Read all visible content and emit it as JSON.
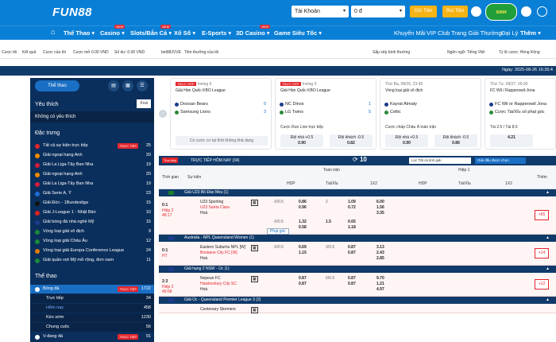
{
  "header": {
    "logo": "FUN88",
    "account_label": "Tài Khoản",
    "balance": "0 đ",
    "deposit_label": "Gửi Tiền",
    "withdraw_label": "Rút Tiền",
    "badge": "SINH THƯỞNG"
  },
  "nav": {
    "items": [
      {
        "label": "Thể Thao",
        "new": false
      },
      {
        "label": "Casino",
        "new": true
      },
      {
        "label": "Slots/Bắn Cá",
        "new": true
      },
      {
        "label": "Xổ Số",
        "new": false
      },
      {
        "label": "E-Sports",
        "new": false
      },
      {
        "label": "3D Casino",
        "new": true
      },
      {
        "label": "Game Siêu Tốc",
        "new": false
      }
    ],
    "right_items": [
      "Khuyến Mãi",
      "VIP Club",
      "Trang Giải Thưởng",
      "Đại Lý",
      "Thêm"
    ],
    "new_tag": "NEW"
  },
  "subbar": {
    "left": [
      "Cược tôi",
      "Kết quả",
      "Cược của tôi",
      "Cược mở 0.00 VND",
      "Số dư: 0.00 VND",
      "bet88JVVE",
      "Tiền thưởng của tôi"
    ],
    "right": [
      "Sắp xếp bình thường",
      "Ngôn ngữ: Tiếng Việt",
      "Tỷ lệ cược: Hồng Kông"
    ]
  },
  "datebar": "Ngày: 2025-08-26 16:35:4",
  "sidebar": {
    "tab_sports": "Thể thao",
    "favorites_title": "Yêu thích",
    "delete_label": "Xoá",
    "no_fav": "Không có yêu thích",
    "featured_title": "Đặc trưng",
    "live_tag": "TRỰC TIẾP",
    "featured": [
      {
        "name": "Tất cả sự kiện trực tiếp",
        "count": "25",
        "live": true
      },
      {
        "name": "Giải ngoại hạng Anh",
        "count": "20",
        "live": false
      },
      {
        "name": "Giải La Liga-Tây Ban Nha",
        "count": "19",
        "live": false
      },
      {
        "name": "Giải ngoại hạng Anh",
        "count": "20",
        "live": false
      },
      {
        "name": "Giải La Liga-Tây Ban Nha",
        "count": "19",
        "live": false
      },
      {
        "name": "Giải Serie A, Ý",
        "count": "23",
        "live": false
      },
      {
        "name": "Giải Đức - 1Bundesliga",
        "count": "15",
        "live": false
      },
      {
        "name": "Giải J-League 1 - Nhật Bản",
        "count": "10",
        "live": false
      },
      {
        "name": "Giải bóng đá nhà nghề Mỹ",
        "count": "15",
        "live": false
      },
      {
        "name": "Vòng loại giải vô địch",
        "count": "9",
        "live": false
      },
      {
        "name": "Vòng loại giải Châu Âu",
        "count": "12",
        "live": false
      },
      {
        "name": "Vòng loại giải Europa Conference League",
        "count": "24",
        "live": false
      },
      {
        "name": "Giải quần vợt Mỹ mở rộng, đơn nam",
        "count": "11",
        "live": false
      }
    ],
    "sports_title": "Thể thao",
    "sports": [
      {
        "name": "Bóng đá",
        "count": "1722",
        "live": true,
        "active": true
      },
      {
        "name": "Trực tiếp",
        "count": "34",
        "live": false,
        "sub": true
      },
      {
        "name": "Hôm nay",
        "count": "458",
        "live": false,
        "sub": true
      },
      {
        "name": "Kèo sớm",
        "count": "1230",
        "live": false,
        "sub": true
      },
      {
        "name": "Chung cuộc",
        "count": "56",
        "live": false,
        "sub": true
      },
      {
        "name": "V-đang đá",
        "count": "91",
        "live": true,
        "sub": false
      }
    ]
  },
  "cards": [
    {
      "header": "Inning 6",
      "tag": "TRỰC TIẾP",
      "league": "Giải Hàn Quốc KBO League",
      "team1": "Doosan Bears",
      "s1": "0",
      "team2": "Samsung Lions",
      "s2": "3",
      "market": "",
      "empty": "Có cược cơ tại thời không khả dụng",
      "odds": []
    },
    {
      "header": "Inning 5",
      "tag": "TRỰC TIẾP",
      "league": "Giải Hàn Quốc KBO League",
      "team1": "NC Dinos",
      "s1": "1",
      "team2": "LG Twins",
      "s2": "5",
      "market": "Cược Run Line trực tiếp",
      "empty": "",
      "odds": [
        {
          "l": "Đội nhà +0.5",
          "v": "0.90"
        },
        {
          "l": "Đội khách -0.5",
          "v": "0.82"
        }
      ]
    },
    {
      "header": "Thứ Ba, 08/26, 23:45",
      "tag": "",
      "league": "Vòng loại giải vô địch",
      "team1": "Kayrat Almaty",
      "s1": "",
      "team2": "Celtic",
      "s2": "",
      "market": "Cược chấp Châu Á toàn trận",
      "empty": "",
      "odds": [
        {
          "l": "Đội nhà +0.5",
          "v": "0.90"
        },
        {
          "l": "Đội khách -0.5",
          "v": "0.86"
        }
      ]
    },
    {
      "header": "Thứ Tư, 08/27, 00:30",
      "tag": "",
      "league": "FC Wil / Rapperswil-Jona",
      "team1": "FC Wil or Rapperswil Jona",
      "s1": "",
      "team2": "Cược Tài/Xỉu số phạt góc",
      "s2": "",
      "market": "Tài 2.5 / Tài 8.5",
      "empty": "",
      "odds": [
        {
          "l": "",
          "v": "4.21"
        }
      ]
    }
  ],
  "live_table": {
    "live_tag": "Trực tiếp",
    "title": "TRỰC TIẾP HÔM NAY (34)",
    "count": "10",
    "select_label": "Lọc Tất cả lịnh giải",
    "btn_label": "Giải đấu được chọn",
    "col_time": "Thời gian",
    "col_event": "Sự kiện",
    "col_full": "Toàn trận",
    "col_half": "Hiệp 1",
    "col_more": "Thêm",
    "sub_cols": [
      "HDP",
      "Tài/Xỉu",
      "1X2",
      "HDP",
      "Tài/Xỉu",
      "1X2"
    ],
    "corner_btn": "Phạt góc",
    "groups": [
      {
        "league": "Giải U23 Bồ Đào Nha (1)",
        "flag": "#1a7d2e",
        "score": "0:1",
        "period": "Hiệp 2",
        "minute": "48:17",
        "team1": "U23 Sporting",
        "team2": "U23 Santa Clara",
        "draw": "Hoà",
        "l1": "-0/0.5",
        "v1": "0.86",
        "v2": "0.96",
        "ou": "2",
        "ov1": "1.09",
        "ov2": "0.72",
        "x1": "6.00",
        "x2": "1.56",
        "x3": "3.35",
        "more": "+55",
        "extra": true,
        "e1": "1.32",
        "e2": "0.58",
        "eou": "1.5",
        "eo1": "0.65",
        "eo2": "1.18"
      },
      {
        "league": "Australia - NPL Queensland Women (1)",
        "flag": "#1e3a8a",
        "score": "0:1",
        "period": "HT",
        "minute": "",
        "team1": "Eastern Suburbs NPL [W]",
        "team2": "Brisbane City FC [W]",
        "draw": "Hoà",
        "l1": "-0/0.5",
        "v1": "0.69",
        "v2": "1.15",
        "ou": "3/3.5",
        "ov1": "0.87",
        "ov2": "0.87",
        "x1": "3.13",
        "x2": "2.43",
        "x3": "2.85",
        "more": "+14",
        "extra": false
      },
      {
        "league": "Giải hạng 2 NSW - Úc (1)",
        "flag": "#1e3a8a",
        "score": "2:3",
        "period": "Hiệp 2",
        "minute": "49:58",
        "team1": "Nepean FC",
        "team2": "Hawkesbury City SC",
        "draw": "Hoà",
        "l1": "",
        "v1": "0.87",
        "v2": "0.87",
        "ou": "6/6.5",
        "ov1": "0.87",
        "ov2": "0.87",
        "x1": "9.70",
        "x2": "1.21",
        "x3": "4.97",
        "more": "+12",
        "extra": false
      },
      {
        "league": "Giải Úc - Queensland Premier League 3 (2)",
        "flag": "#1e3a8a",
        "score": "",
        "period": "",
        "minute": "",
        "team1": "Centenary Stormers",
        "team2": "",
        "draw": "",
        "l1": "",
        "v1": "",
        "v2": "",
        "ou": "",
        "ov1": "",
        "ov2": "",
        "x1": "",
        "x2": "",
        "x3": "",
        "more": "",
        "extra": false
      }
    ]
  },
  "colors": {
    "primary": "#0a7fd6",
    "dark": "#103a6a",
    "sidebar": "#0b2f5c",
    "live": "#e3262d",
    "gold": "#f5b315"
  }
}
